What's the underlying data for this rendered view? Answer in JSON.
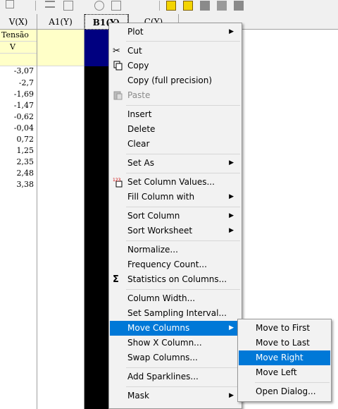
{
  "worksheet": {
    "columns": [
      {
        "header": "V(X)",
        "long_name": "Tensão",
        "units": "V",
        "values": [
          "-3,07",
          "-2,7",
          "-1,69",
          "-1,47",
          "-0,62",
          "-0,04",
          "0,72",
          "1,25",
          "2,35",
          "2,48",
          "3,38"
        ]
      },
      {
        "header": "A1(Y)"
      },
      {
        "header": "B1(Y)",
        "selected": true
      },
      {
        "header": "C(Y)"
      }
    ]
  },
  "context_menu": {
    "items": [
      {
        "label": "Plot",
        "submenu": true
      },
      {
        "label": "Cut",
        "icon": "scissors-icon"
      },
      {
        "label": "Copy",
        "icon": "copy-icon"
      },
      {
        "label": "Copy (full precision)"
      },
      {
        "label": "Paste",
        "icon": "paste-icon",
        "disabled": true
      },
      {
        "label": "Insert"
      },
      {
        "label": "Delete"
      },
      {
        "label": "Clear"
      },
      {
        "label": "Set As",
        "submenu": true
      },
      {
        "label": "Set Column Values...",
        "icon": "set-values-icon"
      },
      {
        "label": "Fill Column with",
        "submenu": true
      },
      {
        "label": "Sort Column",
        "submenu": true
      },
      {
        "label": "Sort Worksheet",
        "submenu": true
      },
      {
        "label": "Normalize..."
      },
      {
        "label": "Frequency Count..."
      },
      {
        "label": "Statistics on Columns...",
        "icon": "sigma-icon"
      },
      {
        "label": "Column Width..."
      },
      {
        "label": "Set Sampling Interval..."
      },
      {
        "label": "Move Columns",
        "submenu": true,
        "highlighted": true
      },
      {
        "label": "Show X Column..."
      },
      {
        "label": "Swap Columns..."
      },
      {
        "label": "Add Sparklines..."
      },
      {
        "label": "Mask",
        "submenu": true
      }
    ]
  },
  "move_columns_submenu": {
    "items": [
      {
        "label": "Move to First"
      },
      {
        "label": "Move to Last"
      },
      {
        "label": "Move Right",
        "highlighted": true
      },
      {
        "label": "Move Left"
      },
      {
        "label": "Open Dialog..."
      }
    ]
  },
  "colors": {
    "highlight": "#0078d7",
    "label_row": "#ffffc8",
    "selected_column": "#000000"
  }
}
